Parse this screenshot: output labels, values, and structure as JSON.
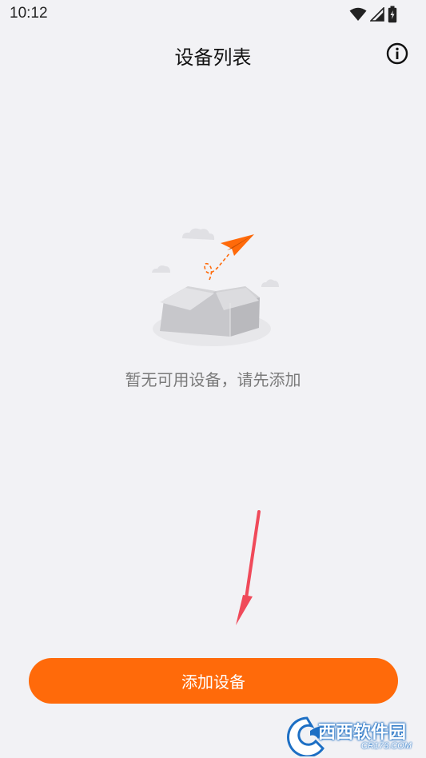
{
  "status_bar": {
    "time": "10:12",
    "icons": [
      "wifi-icon",
      "signal-icon",
      "battery-icon"
    ]
  },
  "header": {
    "title": "设备列表",
    "info_icon": "info-icon"
  },
  "empty_state": {
    "message": "暂无可用设备，请先添加",
    "illustration": "empty-box-paper-plane-illustration"
  },
  "add_button": {
    "label": "添加设备"
  },
  "watermark": {
    "brand": "西西软件园",
    "site": "CR173.COM"
  },
  "colors": {
    "accent": "#ff6a0a",
    "background": "#f2f2f5",
    "annotation_arrow": "#f04a5a"
  }
}
